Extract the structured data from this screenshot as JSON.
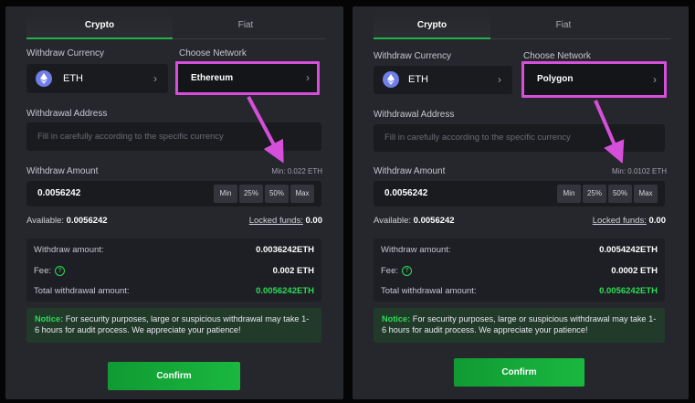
{
  "panels": [
    {
      "tabs": [
        "Crypto",
        "Fiat"
      ],
      "withdraw_currency_label": "Withdraw Currency",
      "currency": "ETH",
      "choose_network_label": "Choose Network",
      "network": "Ethereum",
      "address_label": "Withdrawal Address",
      "address_placeholder": "Fill in carefully according to the specific currency",
      "amount_label": "Withdraw Amount",
      "min_note": "Min: 0.022 ETH",
      "amount_value": "0.0056242",
      "pills": [
        "Min",
        "25%",
        "50%",
        "Max"
      ],
      "available_label": "Available:",
      "available_value": "0.0056242",
      "locked_label": "Locked funds:",
      "locked_value": "0.00",
      "summary": {
        "withdraw_label": "Withdraw amount:",
        "withdraw_value": "0.0036242ETH",
        "fee_label": "Fee:",
        "fee_value": "0.002 ETH",
        "total_label": "Total withdrawal amount:",
        "total_value": "0.0056242ETH"
      },
      "notice_title": "Notice:",
      "notice_text": "For security purposes, large or suspicious withdrawal may take 1-6 hours for audit process. We appreciate your patience!",
      "confirm_label": "Confirm"
    },
    {
      "tabs": [
        "Crypto",
        "Fiat"
      ],
      "withdraw_currency_label": "Withdraw Currency",
      "currency": "ETH",
      "choose_network_label": "Choose Network",
      "network": "Polygon",
      "address_label": "Withdrawal Address",
      "address_placeholder": "Fill in carefully according to the specific currency",
      "amount_label": "Withdraw Amount",
      "min_note": "Min: 0.0102 ETH",
      "amount_value": "0.0056242",
      "pills": [
        "Min",
        "25%",
        "50%",
        "Max"
      ],
      "available_label": "Available:",
      "available_value": "0.0056242",
      "locked_label": "Locked funds:",
      "locked_value": "0.00",
      "summary": {
        "withdraw_label": "Withdraw amount:",
        "withdraw_value": "0.0054242ETH",
        "fee_label": "Fee:",
        "fee_value": "0.0002 ETH",
        "total_label": "Total withdrawal amount:",
        "total_value": "0.0056242ETH"
      },
      "notice_title": "Notice:",
      "notice_text": "For security purposes, large or suspicious withdrawal may take 1-6 hours for audit process. We appreciate your patience!",
      "confirm_label": "Confirm"
    }
  ],
  "colors": {
    "accent": "#1fb544",
    "highlight": "#d64fdb",
    "total_green": "#2bdc55"
  },
  "icons": [
    "eth-icon",
    "chevron-right-icon",
    "question-icon",
    "annotation-arrow"
  ]
}
